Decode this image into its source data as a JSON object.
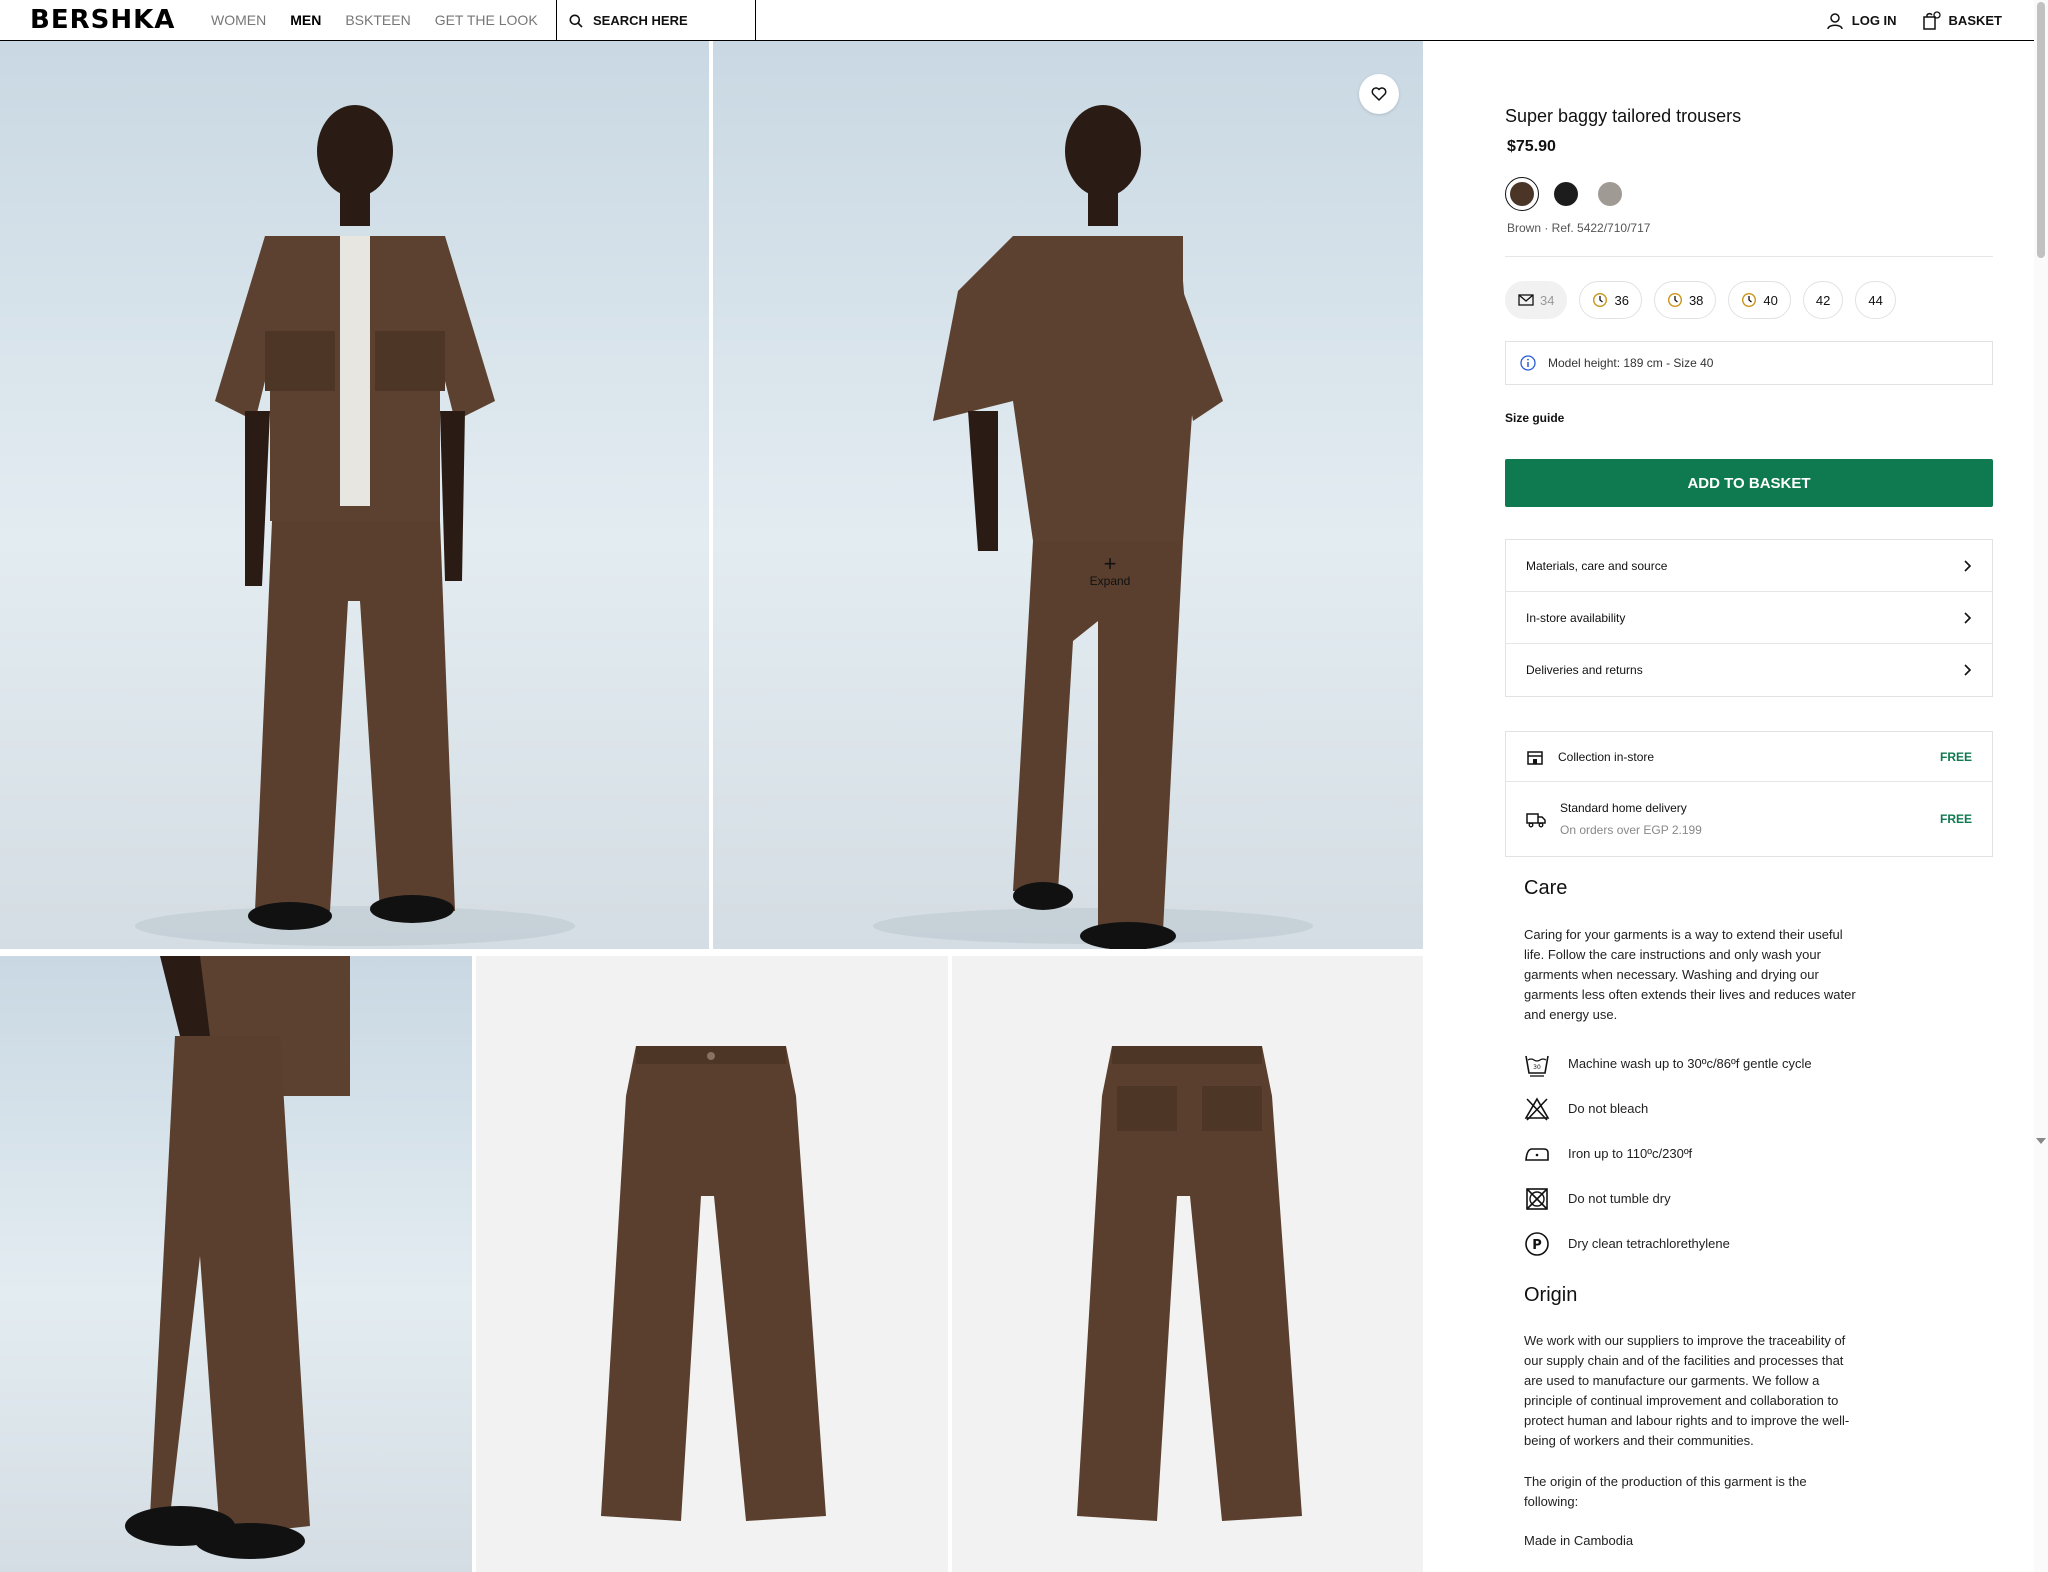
{
  "header": {
    "logo": "BERSHKA",
    "nav": [
      "WOMEN",
      "MEN",
      "BSKTEEN",
      "GET THE LOOK"
    ],
    "active_nav": "MEN",
    "search_label": "SEARCH HERE",
    "login_label": "LOG IN",
    "basket_label": "BASKET"
  },
  "gallery": {
    "expand_label": "Expand"
  },
  "product": {
    "title": "Super baggy tailored trousers",
    "price": "$75.90",
    "colors": [
      {
        "name": "Brown",
        "hex": "#4a3527",
        "selected": true
      },
      {
        "name": "Black",
        "hex": "#1c1c1c",
        "selected": false
      },
      {
        "name": "Grey",
        "hex": "#a09a95",
        "selected": false
      }
    ],
    "color_ref": "Brown · Ref. 5422/710/717",
    "sizes": [
      {
        "label": "34",
        "status": "notify"
      },
      {
        "label": "36",
        "status": "few"
      },
      {
        "label": "38",
        "status": "few"
      },
      {
        "label": "40",
        "status": "few"
      },
      {
        "label": "42",
        "status": "available"
      },
      {
        "label": "44",
        "status": "available"
      }
    ],
    "model_info": "Model height: 189 cm - Size 40",
    "size_guide": "Size guide",
    "add_to_basket": "ADD TO BASKET",
    "accordion": [
      "Materials, care and source",
      "In-store availability",
      "Deliveries and returns"
    ],
    "delivery": {
      "collection_title": "Collection in-store",
      "collection_price": "FREE",
      "home_title": "Standard home delivery",
      "home_sub": "On orders over EGP 2.199",
      "home_price": "FREE"
    }
  },
  "care": {
    "title": "Care",
    "text": "Caring for your garments is a way to extend their useful life. Follow the care instructions and only wash your garments when necessary. Washing and drying our garments less often extends their lives and reduces water and energy use.",
    "items": [
      "Machine wash up to 30ºc/86ºf gentle cycle",
      "Do not bleach",
      "Iron up to 110ºc/230ºf",
      "Do not tumble dry",
      "Dry clean tetrachlorethylene"
    ]
  },
  "origin": {
    "title": "Origin",
    "text": "We work with our suppliers to improve the traceability of our supply chain and of the facilities and processes that are used to manufacture our garments. We follow a principle of continual improvement and collaboration to protect human and labour rights and to improve the well-being of workers and their communities.",
    "text2": "The origin of the production of this garment is the following:",
    "made_in": "Made in Cambodia"
  }
}
